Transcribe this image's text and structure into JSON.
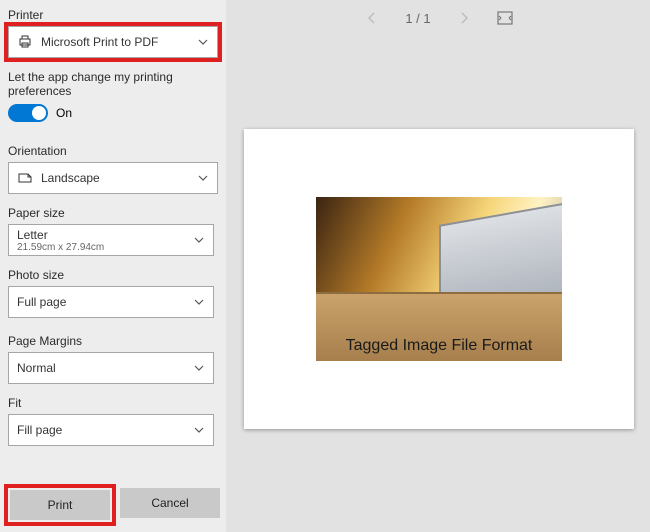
{
  "header": {
    "page_indicator": "1  /  1"
  },
  "left": {
    "printer_label": "Printer",
    "printer_value": "Microsoft Print to PDF",
    "pref_label": "Let the app change my printing preferences",
    "pref_state": "On",
    "orientation_label": "Orientation",
    "orientation_value": "Landscape",
    "paper_label": "Paper size",
    "paper_value": "Letter",
    "paper_dimensions": "21.59cm x 27.94cm",
    "photo_label": "Photo size",
    "photo_value": "Full page",
    "margins_label": "Page Margins",
    "margins_value": "Normal",
    "fit_label": "Fit",
    "fit_value": "Fill page",
    "print_button": "Print",
    "cancel_button": "Cancel"
  },
  "preview": {
    "caption": "Tagged Image File Format"
  }
}
